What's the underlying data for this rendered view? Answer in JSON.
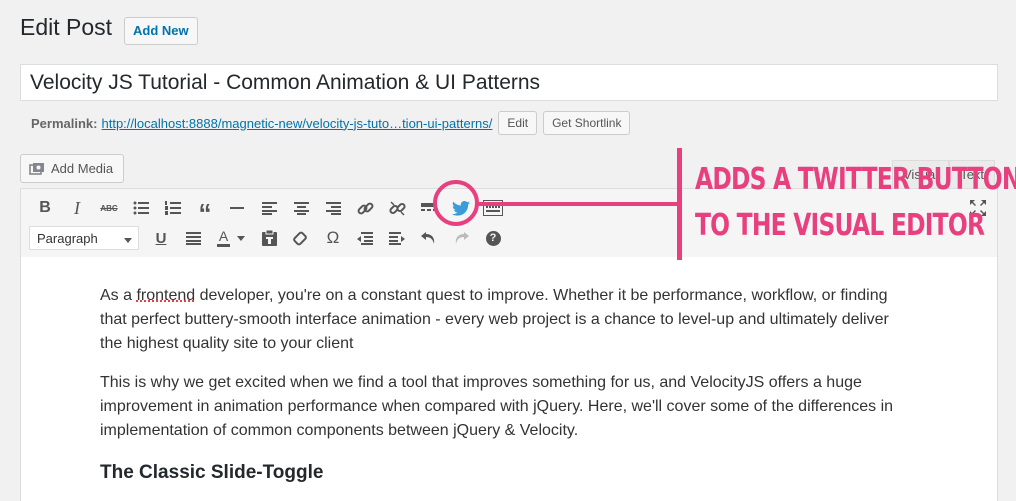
{
  "header": {
    "title": "Edit Post",
    "add_new_label": "Add New"
  },
  "post": {
    "title": "Velocity JS Tutorial - Common Animation & UI Patterns"
  },
  "permalink": {
    "label": "Permalink:",
    "url": "http://localhost:8888/magnetic-new/velocity-js-tuto…tion-ui-patterns/",
    "edit_label": "Edit",
    "shortlink_label": "Get Shortlink"
  },
  "media": {
    "add_media_label": "Add Media"
  },
  "tabs": {
    "visual": "Visual",
    "text": "Text"
  },
  "toolbar": {
    "row1": [
      "bold-icon",
      "italic-icon",
      "strikethrough-icon",
      "bullet-list-icon",
      "numbered-list-icon",
      "blockquote-icon",
      "horizontal-rule-icon",
      "align-left-icon",
      "align-center-icon",
      "align-right-icon",
      "link-icon",
      "unlink-icon",
      "read-more-icon",
      "twitter-icon",
      "toolbar-toggle-icon"
    ],
    "row2": [
      "underline-icon",
      "justify-icon",
      "text-color-icon",
      "paste-text-icon",
      "clear-formatting-icon",
      "special-character-icon",
      "outdent-icon",
      "indent-icon",
      "undo-icon",
      "redo-icon",
      "help-icon"
    ],
    "format_select": "Paragraph",
    "strike_glyph": "ABC",
    "omega_glyph": "Ω",
    "quote_glyph": "“",
    "help_glyph": "?",
    "italic_glyph": "I",
    "bold_glyph": "B",
    "underline_glyph": "U",
    "text_color_glyph": "A"
  },
  "content": {
    "p1_pre": "As a ",
    "p1_spell": "frontend",
    "p1_post": " developer, you're on a constant quest to improve. Whether it be performance, workflow, or finding that perfect buttery-smooth interface animation - every web project is a chance to level-up and ultimately deliver the highest quality site to your client",
    "p2": "This is why we get excited when we find a tool that improves something for us, and VelocityJS offers a huge improvement in animation performance when compared with jQuery. Here, we'll cover some of the differences in implementation of common components between jQuery & Velocity.",
    "h3": "The Classic Slide-Toggle"
  },
  "annotation": {
    "line1": "ADDS A TWITTER BUTTON",
    "line2": "TO THE VISUAL EDITOR",
    "color": "#e83f7f"
  }
}
